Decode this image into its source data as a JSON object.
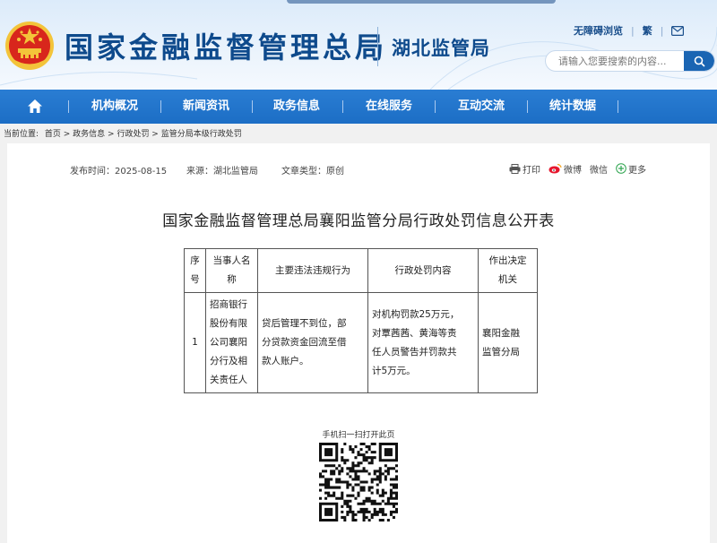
{
  "header": {
    "site_title": "国家金融监督管理总局",
    "sub_title": "湖北监管局",
    "links": [
      "无障碍浏览",
      "繁"
    ],
    "search_placeholder": "请输入您要搜索的内容...",
    "colors": {
      "brand_blue": "#0e4a8c",
      "nav_blue": "#1c6ec5",
      "emblem_red": "#d8261c",
      "emblem_gold": "#f3c43a"
    }
  },
  "nav": {
    "items": [
      "机构概况",
      "新闻资讯",
      "政务信息",
      "在线服务",
      "互动交流",
      "统计数据"
    ]
  },
  "breadcrumb": {
    "label": "当前位置:",
    "path": "首页 > 政务信息 > 行政处罚 > 监管分局本级行政处罚"
  },
  "article": {
    "publish_time": "发布时间：2025-08-15",
    "source": "来源：湖北监管局",
    "doc_type": "文章类型：原创",
    "tools": {
      "print": "打印",
      "weibo": "微博",
      "wechat": "微信",
      "more": "更多"
    },
    "title": "国家金融监督管理总局襄阳监管分局行政处罚信息公开表"
  },
  "table": {
    "headers": {
      "no": [
        "序",
        "号"
      ],
      "party": [
        "当事人名",
        "称"
      ],
      "violation": "主要违法违规行为",
      "penalty": "行政处罚内容",
      "authority": [
        "作出决定",
        "机关"
      ]
    },
    "rows": [
      {
        "no": "1",
        "party": [
          "招商银行",
          "股份有限",
          "公司襄阳",
          "分行及相",
          "关责任人"
        ],
        "violation": [
          "贷后管理不到位，部",
          "分贷款资金回流至借",
          "款人账户。"
        ],
        "penalty": [
          "对机构罚款25万元，",
          "对覃茜茜、黄海等责",
          "任人员警告并罚款共",
          "计5万元。"
        ],
        "authority": [
          "襄阳金融",
          "监管分局"
        ]
      }
    ]
  },
  "qr": {
    "label": "手机扫一扫打开此页"
  }
}
